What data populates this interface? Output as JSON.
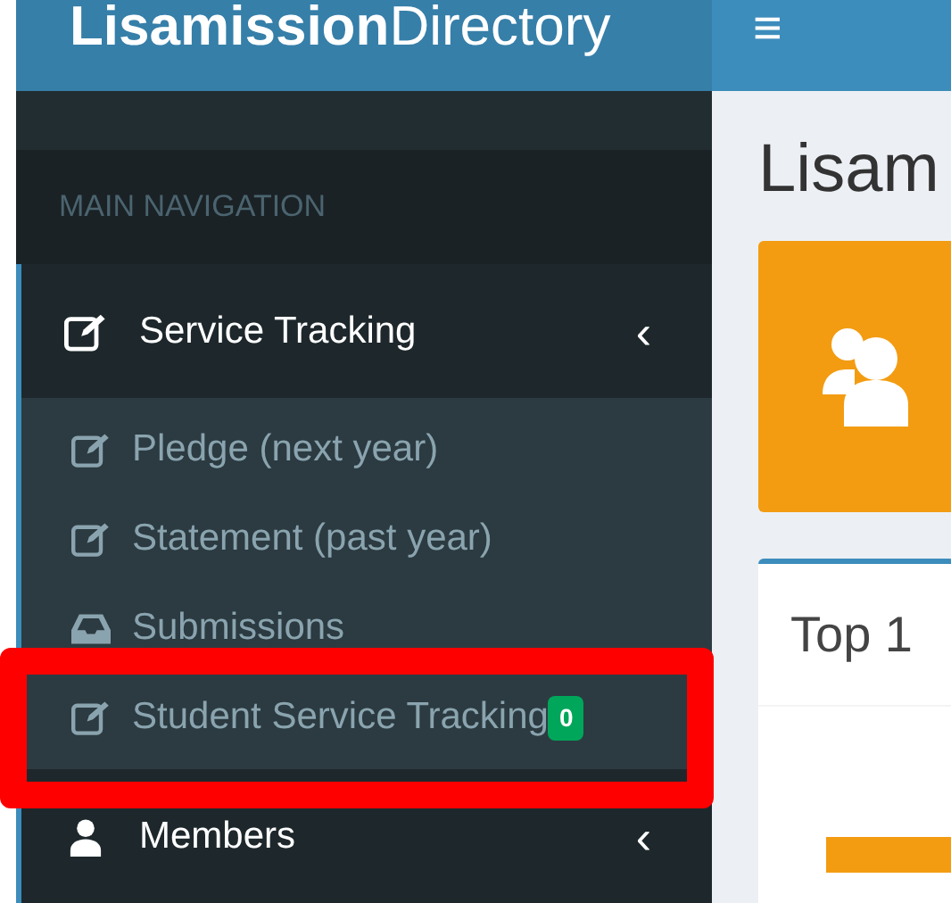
{
  "header": {
    "logo": "**Lisamission**Directory",
    "menu_toggle": "≡"
  },
  "sidebar": {
    "heading": "MAIN NAVIGATION",
    "items": [
      {
        "label": "Service Tracking",
        "kind": "edit",
        "caret": "‹",
        "children": [
          {
            "label": "Pledge (next year)",
            "kind": "edit",
            "highlighted": false
          },
          {
            "label": "Statement (past year)",
            "kind": "edit",
            "highlighted": false
          },
          {
            "label": "Submissions",
            "kind": "inbox",
            "highlighted": false
          },
          {
            "label": "Student Service Tracking",
            "kind": "edit",
            "badge": "0",
            "highlighted": true
          }
        ]
      },
      {
        "label": "Members",
        "kind": "user",
        "caret": "‹"
      }
    ]
  },
  "content": {
    "title": "Lisam",
    "box_title": "Top 1"
  }
}
